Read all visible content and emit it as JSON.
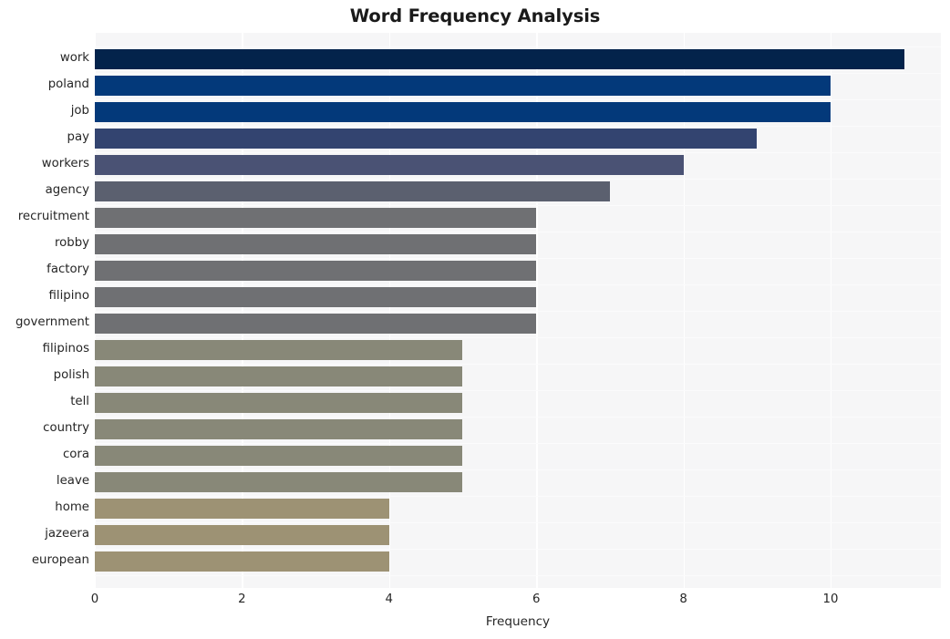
{
  "chart_data": {
    "type": "bar",
    "orientation": "horizontal",
    "title": "Word Frequency Analysis",
    "xlabel": "Frequency",
    "ylabel": "",
    "xlim": [
      0,
      11.5
    ],
    "xticks": [
      0,
      2,
      4,
      6,
      8,
      10
    ],
    "xtick_labels": [
      "0",
      "2",
      "4",
      "6",
      "8",
      "10"
    ],
    "grid": true,
    "legend": null,
    "categories": [
      "work",
      "poland",
      "job",
      "pay",
      "workers",
      "agency",
      "recruitment",
      "robby",
      "factory",
      "filipino",
      "government",
      "filipinos",
      "polish",
      "tell",
      "country",
      "cora",
      "leave",
      "home",
      "jazeera",
      "european"
    ],
    "values": [
      11,
      10,
      10,
      9,
      8,
      7,
      6,
      6,
      6,
      6,
      6,
      5,
      5,
      5,
      5,
      5,
      5,
      4,
      4,
      4
    ],
    "bar_colors": [
      "#03234b",
      "#03397a",
      "#03397a",
      "#334470",
      "#4a5274",
      "#5b606f",
      "#6f7073",
      "#6f7073",
      "#6f7073",
      "#6f7073",
      "#6f7073",
      "#888878",
      "#888878",
      "#888878",
      "#888878",
      "#888878",
      "#888878",
      "#9d9274",
      "#9d9274",
      "#9d9274"
    ],
    "plot_background": "#f6f6f7",
    "gridline_color": "#ffffff",
    "page_background": "#ffffff",
    "text_color": "#262626"
  }
}
